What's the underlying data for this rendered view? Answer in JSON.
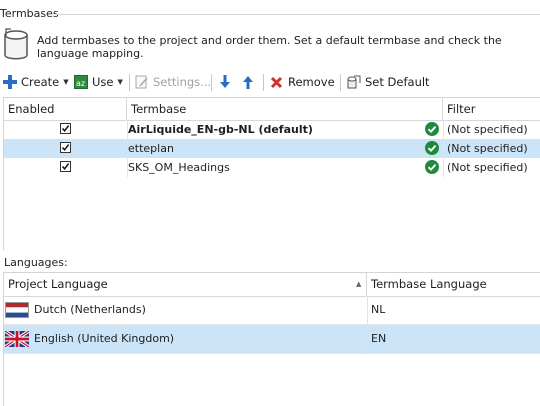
{
  "section": {
    "title": "Termbases"
  },
  "description": "Add termbases to the project and order them. Set a default termbase and check the language mapping.",
  "toolbar": {
    "create": "Create",
    "use": "Use",
    "settings": "Settings...",
    "remove": "Remove",
    "set_default": "Set Default"
  },
  "termbases": {
    "columns": {
      "enabled": "Enabled",
      "termbase": "Termbase",
      "filter": "Filter"
    },
    "rows": [
      {
        "enabled": true,
        "name": "AirLiquide_EN-gb-NL (default)",
        "filter": "(Not specified)",
        "is_default": true,
        "selected": false
      },
      {
        "enabled": true,
        "name": "etteplan",
        "filter": "(Not specified)",
        "is_default": false,
        "selected": true
      },
      {
        "enabled": true,
        "name": "SKS_OM_Headings",
        "filter": "(Not specified)",
        "is_default": false,
        "selected": false
      }
    ]
  },
  "languages": {
    "label": "Languages:",
    "columns": {
      "project": "Project Language",
      "termbase": "Termbase Language"
    },
    "rows": [
      {
        "flag": "netherlands-flag",
        "project": "Dutch (Netherlands)",
        "termbase": "NL",
        "selected": false
      },
      {
        "flag": "uk-flag",
        "project": "English (United Kingdom)",
        "termbase": "EN",
        "selected": true
      }
    ]
  },
  "colors": {
    "selection": "#cce4f7",
    "status_ok": "#1e8a3b",
    "arrow_blue": "#2b6cc4",
    "remove_red": "#d0302a"
  }
}
